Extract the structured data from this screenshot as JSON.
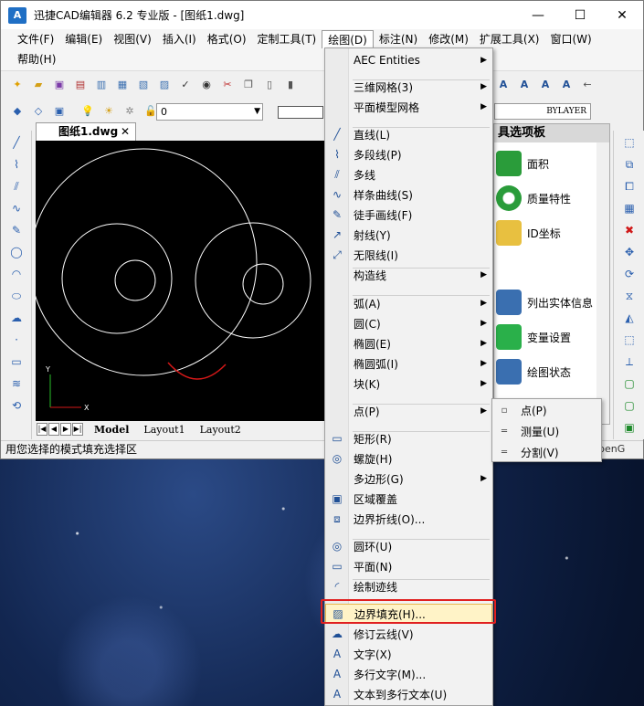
{
  "window": {
    "title": "迅捷CAD编辑器 6.2 专业版  - [图纸1.dwg]",
    "logo": "A",
    "buttons": {
      "minimize": "—",
      "maximize": "☐",
      "close": "✕"
    }
  },
  "menubar": {
    "row1": [
      {
        "id": "file",
        "label": "文件(F)"
      },
      {
        "id": "edit",
        "label": "编辑(E)"
      },
      {
        "id": "view",
        "label": "视图(V)"
      },
      {
        "id": "insert",
        "label": "插入(I)"
      },
      {
        "id": "format",
        "label": "格式(O)"
      },
      {
        "id": "custom-tools",
        "label": "定制工具(T)"
      },
      {
        "id": "draw",
        "label": "绘图(D)"
      },
      {
        "id": "dimension",
        "label": "标注(N)"
      },
      {
        "id": "modify",
        "label": "修改(M)"
      },
      {
        "id": "ext-tools",
        "label": "扩展工具(X)"
      },
      {
        "id": "window",
        "label": "窗口(W)"
      }
    ],
    "row2": [
      {
        "id": "help",
        "label": "帮助(H)"
      }
    ]
  },
  "layer": {
    "current": "0"
  },
  "bylayer": "BYLAYER",
  "document": {
    "tab": "图纸1.dwg",
    "close": "✕"
  },
  "layouts": {
    "model": "Model",
    "layout1": "Layout1",
    "layout2": "Layout2"
  },
  "status": {
    "text": "用您选择的模式填充选择区",
    "right": "penG"
  },
  "panel": {
    "title": "具选项板",
    "items": [
      {
        "label": "面积",
        "icon": "area-ruler-icon"
      },
      {
        "label": "质量特性",
        "icon": "mass-ring-icon"
      },
      {
        "label": "ID坐标",
        "icon": "id-coordinate-icon"
      },
      {
        "label": "列出实体信息",
        "icon": "list-info-icon"
      },
      {
        "label": "变量设置",
        "icon": "variable-check-icon"
      },
      {
        "label": "绘图状态",
        "icon": "drawing-status-icon"
      }
    ]
  },
  "draw_menu": {
    "items": [
      {
        "label": "AEC Entities",
        "sub": true
      },
      {
        "label": "三维网格(3)",
        "sub": true
      },
      {
        "label": "平面模型网格",
        "sub": true
      },
      {
        "label": "直线(L)"
      },
      {
        "label": "多段线(P)"
      },
      {
        "label": "多线"
      },
      {
        "label": "样条曲线(S)"
      },
      {
        "label": "徒手画线(F)"
      },
      {
        "label": "射线(Y)"
      },
      {
        "label": "无限线(I)"
      },
      {
        "label": "构造线",
        "sub": true
      },
      {
        "label": "弧(A)",
        "sub": true
      },
      {
        "label": "圆(C)",
        "sub": true
      },
      {
        "label": "椭圆(E)",
        "sub": true
      },
      {
        "label": "椭圆弧(I)",
        "sub": true
      },
      {
        "label": "块(K)",
        "sub": true
      },
      {
        "label": "点(P)",
        "sub": true
      },
      {
        "label": "矩形(R)"
      },
      {
        "label": "螺旋(H)"
      },
      {
        "label": "多边形(G)",
        "sub": true
      },
      {
        "label": "区域覆盖"
      },
      {
        "label": "边界折线(O)..."
      },
      {
        "label": "圆环(U)"
      },
      {
        "label": "平面(N)"
      },
      {
        "label": "绘制迹线"
      },
      {
        "label": "边界填充(H)..."
      },
      {
        "label": "修订云线(V)"
      },
      {
        "label": "文字(X)"
      },
      {
        "label": "多行文字(M)..."
      },
      {
        "label": "文本到多行文本(U)"
      }
    ]
  },
  "point_submenu": {
    "items": [
      {
        "label": "点(P)"
      },
      {
        "label": "测量(U)"
      },
      {
        "label": "分割(V)"
      }
    ]
  },
  "axes": {
    "y": "Y",
    "x": "X"
  },
  "colors": {
    "highlight_border": "#e02020",
    "menu_hover": "#fff3c7",
    "drawing_line": "#ffffff",
    "smile": "#d21818"
  }
}
